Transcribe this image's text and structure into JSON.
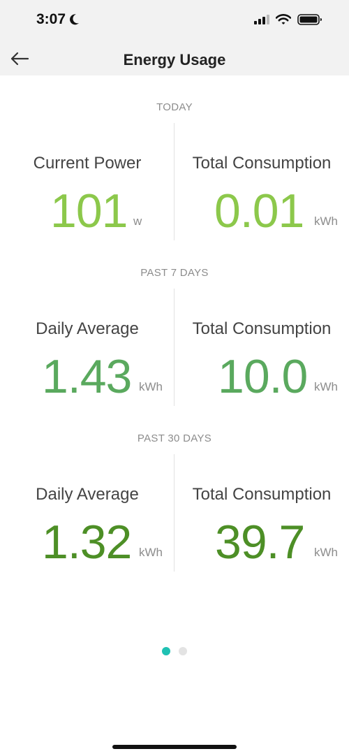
{
  "status_bar": {
    "time": "3:07",
    "moon_icon": "moon-icon",
    "signal_icon": "cellular-signal-icon",
    "wifi_icon": "wifi-icon",
    "battery_icon": "battery-icon"
  },
  "header": {
    "title": "Energy Usage",
    "back_icon": "arrow-left-icon"
  },
  "sections": [
    {
      "label": "TODAY",
      "left": {
        "label": "Current Power",
        "value": "101",
        "unit": "w"
      },
      "right": {
        "label": "Total Consumption",
        "value": "0.01",
        "unit": "kWh"
      },
      "color": "#8cc84b"
    },
    {
      "label": "PAST 7 DAYS",
      "left": {
        "label": "Daily Average",
        "value": "1.43",
        "unit": "kWh"
      },
      "right": {
        "label": "Total Consumption",
        "value": "10.0",
        "unit": "kWh"
      },
      "color": "#5aa95e"
    },
    {
      "label": "PAST 30 DAYS",
      "left": {
        "label": "Daily Average",
        "value": "1.32",
        "unit": "kWh"
      },
      "right": {
        "label": "Total Consumption",
        "value": "39.7",
        "unit": "kWh"
      },
      "color": "#4d8f26"
    }
  ],
  "pager": {
    "active_color": "#1fc1b3",
    "inactive_color": "#e3e3e3",
    "active_index": 0
  }
}
